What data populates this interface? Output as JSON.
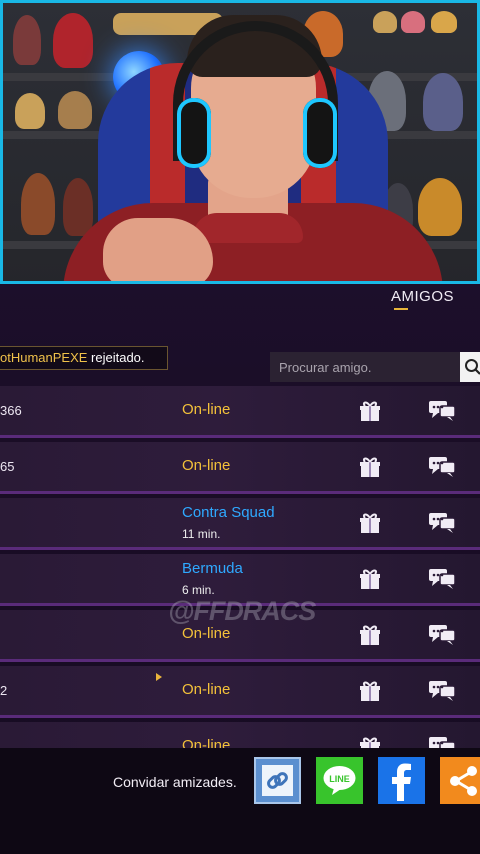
{
  "header": {
    "title": "AMIGOS"
  },
  "toast": {
    "name": "otHumanPEXE",
    "suffix": " rejeitado."
  },
  "search": {
    "placeholder": "Procurar amigo."
  },
  "friends": [
    {
      "name": "366",
      "status": "On-line",
      "sub": ""
    },
    {
      "name": "65",
      "status": "On-line",
      "sub": ""
    },
    {
      "name": "",
      "status": "Contra Squad",
      "sub": "11 min."
    },
    {
      "name": "",
      "status": "Bermuda",
      "sub": "6 min."
    },
    {
      "name": "",
      "status": "On-line",
      "sub": ""
    },
    {
      "name": "2",
      "status": "On-line",
      "sub": ""
    },
    {
      "name": "",
      "status": "On-line",
      "sub": ""
    }
  ],
  "watermark": "@FFDRACS",
  "invite": {
    "label": "Convidar amizades."
  },
  "colors": {
    "online": "#f3c13a",
    "in_match": "#2fa9ff",
    "webcam_border": "#19b8e6",
    "row_divider": "#5a2b7a"
  },
  "icons": {
    "gift": "gift-icon",
    "chat": "chat-icon",
    "search": "search-icon",
    "link": "link-icon",
    "line": "line-icon",
    "facebook": "facebook-icon",
    "share": "share-icon"
  }
}
